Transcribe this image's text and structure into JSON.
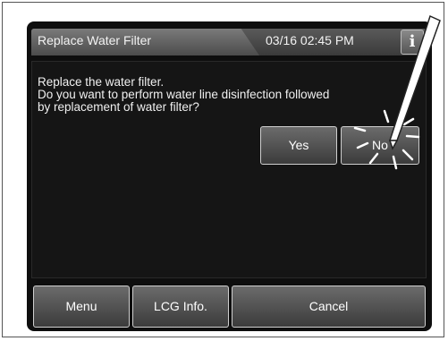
{
  "header": {
    "title": "Replace Water Filter",
    "datetime": "03/16 02:45 PM",
    "info_label": "i"
  },
  "dialog": {
    "line1": "Replace the water filter.",
    "line2": "Do you want to perform water line disinfection followed",
    "line3": "by replacement of water filter?",
    "yes_label": "Yes",
    "no_label": "No"
  },
  "footer": {
    "menu_label": "Menu",
    "lcg_label": "LCG Info.",
    "cancel_label": "Cancel"
  },
  "icons": {
    "pointer": "stylus-icon",
    "tap": "tap-burst-icon"
  }
}
